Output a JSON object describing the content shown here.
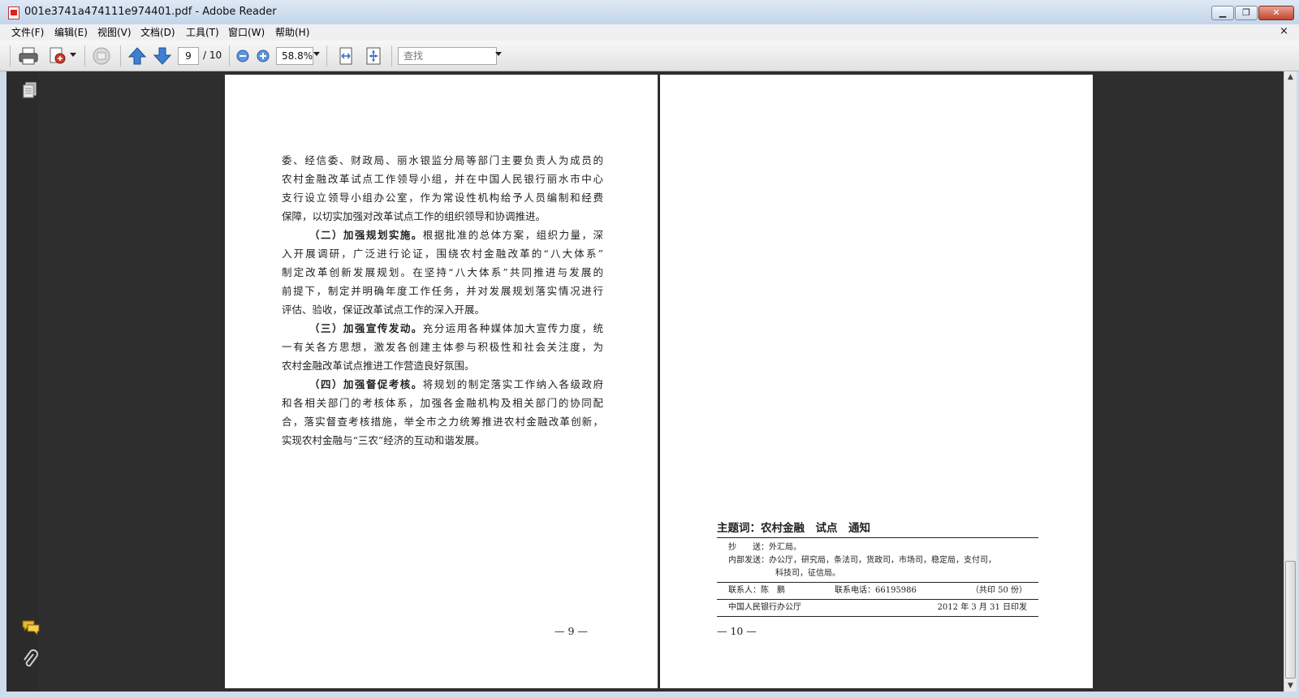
{
  "window": {
    "title": "001e3741a474111e974401.pdf - Adobe Reader"
  },
  "menu": {
    "items": [
      "文件(F)",
      "编辑(E)",
      "视图(V)",
      "文档(D)",
      "工具(T)",
      "窗口(W)",
      "帮助(H)"
    ],
    "close_glyph": "×"
  },
  "toolbar": {
    "page_current": "9",
    "page_total": "/ 10",
    "zoom": "58.8%",
    "search_placeholder": "查找"
  },
  "icons": {
    "print": "print-icon",
    "save": "create-pdf-icon",
    "collab": "collaborate-icon",
    "prev": "arrow-up-icon",
    "next": "arrow-down-icon",
    "zoom_out": "zoom-out-icon",
    "zoom_in": "zoom-in-icon",
    "fit_width": "fit-width-icon",
    "fit_page": "fit-page-icon",
    "pages_panel": "pages-icon",
    "comments": "comments-icon",
    "attachments": "attachment-icon"
  },
  "page9": {
    "lines": [
      {
        "text": "委、经信委、财政局、丽水银监分局等部门主要负责人为成员的"
      },
      {
        "text": "农村金融改革试点工作领导小组，并在中国人民银行丽水市中心"
      },
      {
        "text": "支行设立领导小组办公室，作为常设性机构给予人员编制和经费"
      },
      {
        "text": "保障，以切实加强对改革试点工作的组织领导和协调推进。",
        "last": true
      },
      {
        "bold": "（二）加强规划实施。",
        "text": "根据批准的总体方案，组织力量，深",
        "indent": true
      },
      {
        "text": "入开展调研，广泛进行论证，围绕农村金融改革的“八大体系”"
      },
      {
        "text": "制定改革创新发展规划。在坚持“八大体系”共同推进与发展的"
      },
      {
        "text": "前提下，制定并明确年度工作任务，并对发展规划落实情况进行"
      },
      {
        "text": "评估、验收，保证改革试点工作的深入开展。",
        "last": true
      },
      {
        "bold": "（三）加强宣传发动。",
        "text": "充分运用各种媒体加大宣传力度，统",
        "indent": true
      },
      {
        "text": "一有关各方思想，激发各创建主体参与积极性和社会关注度，为"
      },
      {
        "text": "农村金融改革试点推进工作营造良好氛围。",
        "last": true
      },
      {
        "bold": "（四）加强督促考核。",
        "text": "将规划的制定落实工作纳入各级政府",
        "indent": true
      },
      {
        "text": "和各相关部门的考核体系，加强各金融机构及相关部门的协同配"
      },
      {
        "text": "合，落实督查考核措施，举全市之力统筹推进农村金融改革创新，"
      },
      {
        "text": "实现农村金融与“三农”经济的互动和谐发展。",
        "last": true
      }
    ],
    "page_number": "— 9 —"
  },
  "page10": {
    "keywords": "主题词：农村金融　试点　通知",
    "cc": "抄　　送：外汇局。",
    "internal_1": "内部发送：办公厅，研究局，条法司，货政司，市场司，稳定局，支付司，",
    "internal_2": "科技司，征信局。",
    "contact": "联系人：陈　鹏",
    "phone": "联系电话：66195986",
    "copies": "（共印 50 份）",
    "issuer": "中国人民银行办公厅",
    "date": "2012 年 3 月 31 日印发",
    "page_number": "— 10 —"
  }
}
